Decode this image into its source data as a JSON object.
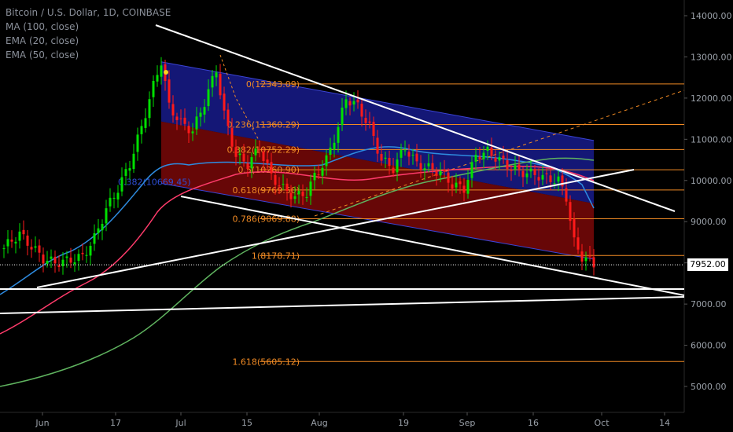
{
  "header": {
    "title": "Bitcoin / U.S. Dollar, 1D, COINBASE",
    "indicators": [
      "MA (100, close)",
      "EMA (20, close)",
      "EMA (50, close)"
    ]
  },
  "chart_data": {
    "type": "candlestick",
    "yaxis": {
      "ticks": [
        "14000.00",
        "13000.00",
        "12000.00",
        "11000.00",
        "10000.00",
        "9000.00",
        "8000.00",
        "7000.00",
        "6000.00",
        "5000.00"
      ],
      "ylim": [
        4700,
        14250
      ]
    },
    "xaxis": {
      "ticks": [
        "Jun",
        "17",
        "Jul",
        "15",
        "Aug",
        "19",
        "Sep",
        "16",
        "Oct",
        "14"
      ]
    },
    "current_price": "7952.00",
    "fibonacci": [
      {
        "label": "0(12343.09)",
        "value": 12343.09
      },
      {
        "label": "0.236(11360.29)",
        "value": 11360.29
      },
      {
        "label": "0.382(10752.29)",
        "value": 10752.29
      },
      {
        "label": "0.5(10260.90)",
        "value": 10260.9
      },
      {
        "label": "0.618(9769.50)",
        "value": 9769.5
      },
      {
        "label": "0.786(9069.88)",
        "value": 9069.88
      },
      {
        "label": "1(8178.71)",
        "value": 8178.71
      },
      {
        "label": "1.618(5605.12)",
        "value": 5605.12
      }
    ],
    "extra_label": "0.382(10669.45)",
    "colors": {
      "background": "#000000",
      "up": "#00e000",
      "down": "#ff1a1a",
      "fib": "#f08a24",
      "ema20": "#2e8bdf",
      "ema50": "#ff3b6b",
      "ma100": "#5fb35f",
      "channel_blue": "#1b1f9e",
      "channel_red": "#8a0a0a"
    }
  }
}
